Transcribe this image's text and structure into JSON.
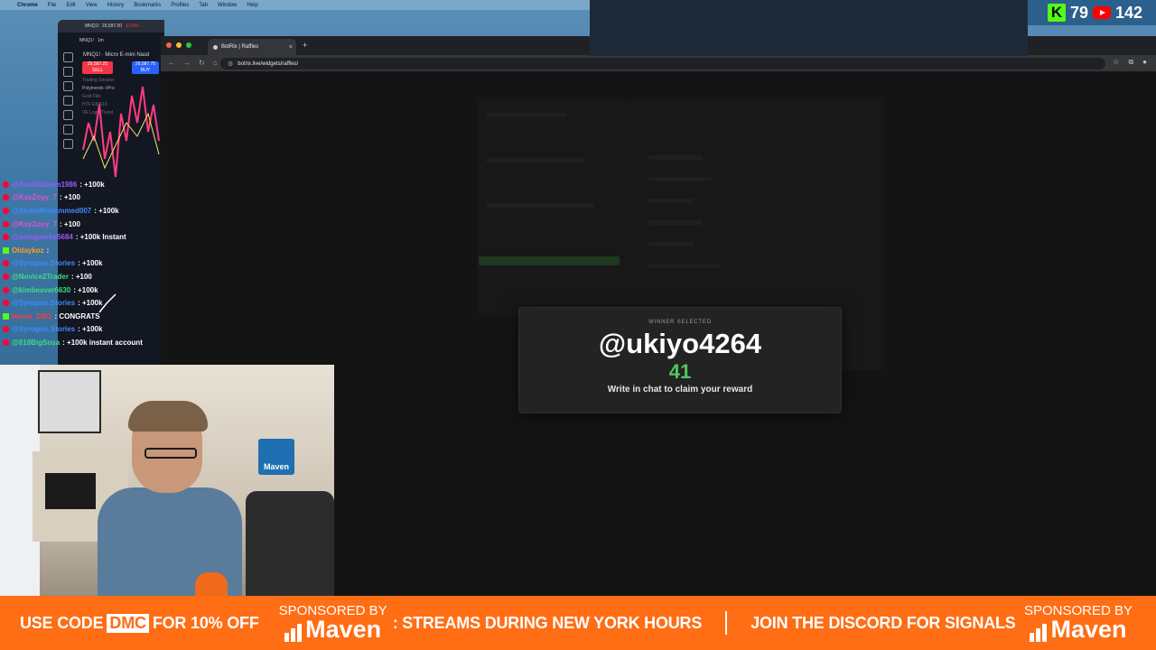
{
  "menubar": {
    "items": [
      "Chrome",
      "File",
      "Edit",
      "View",
      "History",
      "Bookmarks",
      "Profiles",
      "Tab",
      "Window",
      "Help"
    ]
  },
  "trading": {
    "symbol": "MNQ1!",
    "price": "29,587.00",
    "change": "-0.03%",
    "title": "MNQ1! · Micro E-mini Nasd",
    "timeframe": "1m",
    "sell_price": "29,587.25",
    "sell_label": "SELL",
    "spread": "0.25",
    "qty": "1",
    "buy_price": "29,587.75",
    "buy_label": "BUY",
    "indicators": [
      "Trading Session",
      "Polytrends +Pro",
      "Gold Fills",
      "HTF EMA10",
      "VE Logic Trend"
    ]
  },
  "chat": [
    {
      "platform": "youtube",
      "user": "@AmaliDumm1986",
      "msg": ": +100k",
      "color": "#9b59ff"
    },
    {
      "platform": "youtube",
      "user": "@KayZoyy_7",
      "msg": ": +100",
      "color": "#e64dd8"
    },
    {
      "platform": "youtube",
      "user": "@AbdulMohammed007",
      "msg": ": +100k",
      "color": "#3d8bff"
    },
    {
      "platform": "youtube",
      "user": "@KayZoyy_7",
      "msg": ": +100",
      "color": "#e64dd8"
    },
    {
      "platform": "youtube",
      "user": "@samgoerke5684",
      "msg": ": +100k Instant",
      "color": "#9b59ff"
    },
    {
      "platform": "kick",
      "user": "Oldaykoz",
      "msg": ":",
      "color": "#ff9f1c"
    },
    {
      "platform": "youtube",
      "user": "@Synapse.Stories",
      "msg": ": +100k",
      "color": "#3d8bff"
    },
    {
      "platform": "youtube",
      "user": "@Novice2Trader",
      "msg": ": +100",
      "color": "#3ddc84"
    },
    {
      "platform": "youtube",
      "user": "@kimbeaver6630",
      "msg": ": +100k",
      "color": "#3ddc84"
    },
    {
      "platform": "youtube",
      "user": "@Synapse.Stories",
      "msg": ": +100k",
      "color": "#3d8bff"
    },
    {
      "platform": "kick",
      "user": "baron_2461",
      "msg": ": CONGRATS",
      "color": "#ff3b3b"
    },
    {
      "platform": "youtube",
      "user": "@Synapse.Stories",
      "msg": ": +100k",
      "color": "#3d8bff"
    },
    {
      "platform": "youtube",
      "user": "@810BigSosa",
      "msg": ": +100k instant account",
      "color": "#3ddc84"
    }
  ],
  "browser": {
    "tab_title": "BotRix | Raffles",
    "url": "botrix.live/widgets/raffles/"
  },
  "modal": {
    "kicker": "WINNER SELECTED",
    "winner": "@ukiyo4264",
    "count": "41",
    "hint": "Write in chat to claim your reward"
  },
  "webcam": {
    "sign": "Maven"
  },
  "stats": {
    "kick_viewers": "79",
    "youtube_viewers": "142"
  },
  "banner": {
    "use_code": "USE CODE",
    "code": "DMC",
    "offer": "FOR 10% OFF",
    "sponsored_by": "SPONSORED BY",
    "brand": "Maven",
    "streams": ": STREAMS DURING NEW YORK HOURS",
    "discord": "JOIN THE DISCORD FOR SIGNALS"
  }
}
